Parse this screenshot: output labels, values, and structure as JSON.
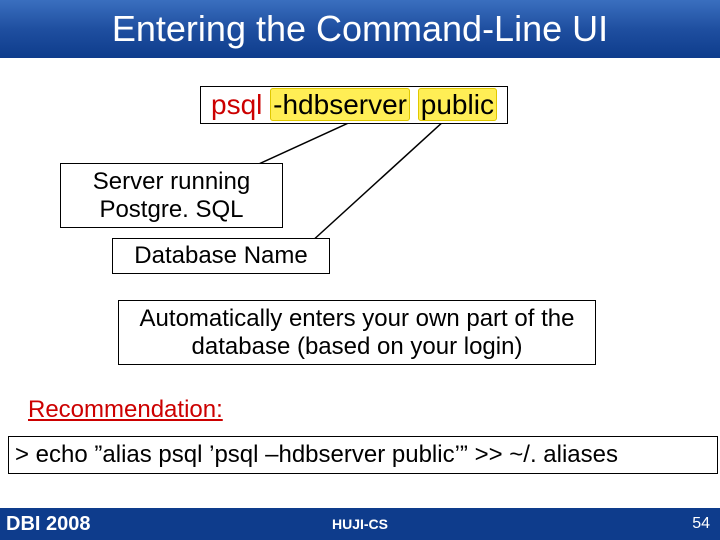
{
  "title": "Entering the Command-Line UI",
  "command": {
    "psql": "psql",
    "space1": " ",
    "hflag_server": "-hdbserver",
    "space2": " ",
    "dbname": "public"
  },
  "labels": {
    "server": "Server running Postgre. SQL",
    "database_name": "Database Name",
    "auto_note": "Automatically enters your own part of the database (based on your login)"
  },
  "recommendation_heading": "Recommendation:",
  "alias_cmd": "> echo ”alias psql ’psql –hdbserver public’” >> ~/. aliases",
  "footer": {
    "left": "DBI 2008",
    "center": "HUJI-CS",
    "pageno": "54"
  }
}
